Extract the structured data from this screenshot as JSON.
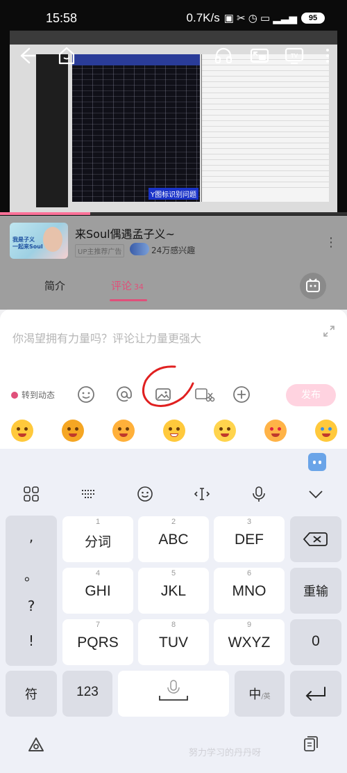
{
  "status_bar": {
    "time": "15:58",
    "net_speed": "0.7K/s",
    "battery": "95"
  },
  "video": {
    "caption": "Y图标识别问题",
    "progress_fraction": 0.26
  },
  "ad": {
    "title": "来Soul偶遇孟子义~",
    "badge": "UP主推荐广告",
    "interest": "24万感兴趣",
    "thumb_text": "我是子义\n一起来Soul"
  },
  "tabs": {
    "intro": "简介",
    "comments": "评论",
    "comment_count": "34"
  },
  "compose": {
    "placeholder": "你渴望拥有力量吗？评论让力量更强大",
    "repost_label": "转到动态",
    "send_label": "发布"
  },
  "keyboard": {
    "keys": [
      {
        "num": "1",
        "label": "分词"
      },
      {
        "num": "2",
        "label": "ABC"
      },
      {
        "num": "3",
        "label": "DEF"
      },
      {
        "num": "4",
        "label": "GHI"
      },
      {
        "num": "5",
        "label": "JKL"
      },
      {
        "num": "6",
        "label": "MNO"
      },
      {
        "num": "7",
        "label": "PQRS"
      },
      {
        "num": "8",
        "label": "TUV"
      },
      {
        "num": "9",
        "label": "WXYZ"
      }
    ],
    "punct": [
      ",",
      "。",
      "?",
      "!"
    ],
    "reinput": "重输",
    "zero": "0",
    "symbol": "符",
    "num_toggle": "123",
    "lang": "中",
    "lang_sub": "/英"
  },
  "watermark": "努力学习的丹丹呀",
  "icons": {
    "back": "back-arrow-icon",
    "home": "home-icon",
    "headphones": "headphones-icon",
    "pip": "pip-icon",
    "tv": "tv-cast-icon",
    "more": "more-vertical-icon"
  },
  "colors": {
    "accent": "#e0507a",
    "annotation": "#e02020",
    "send_disabled": "#ffd3e0"
  }
}
